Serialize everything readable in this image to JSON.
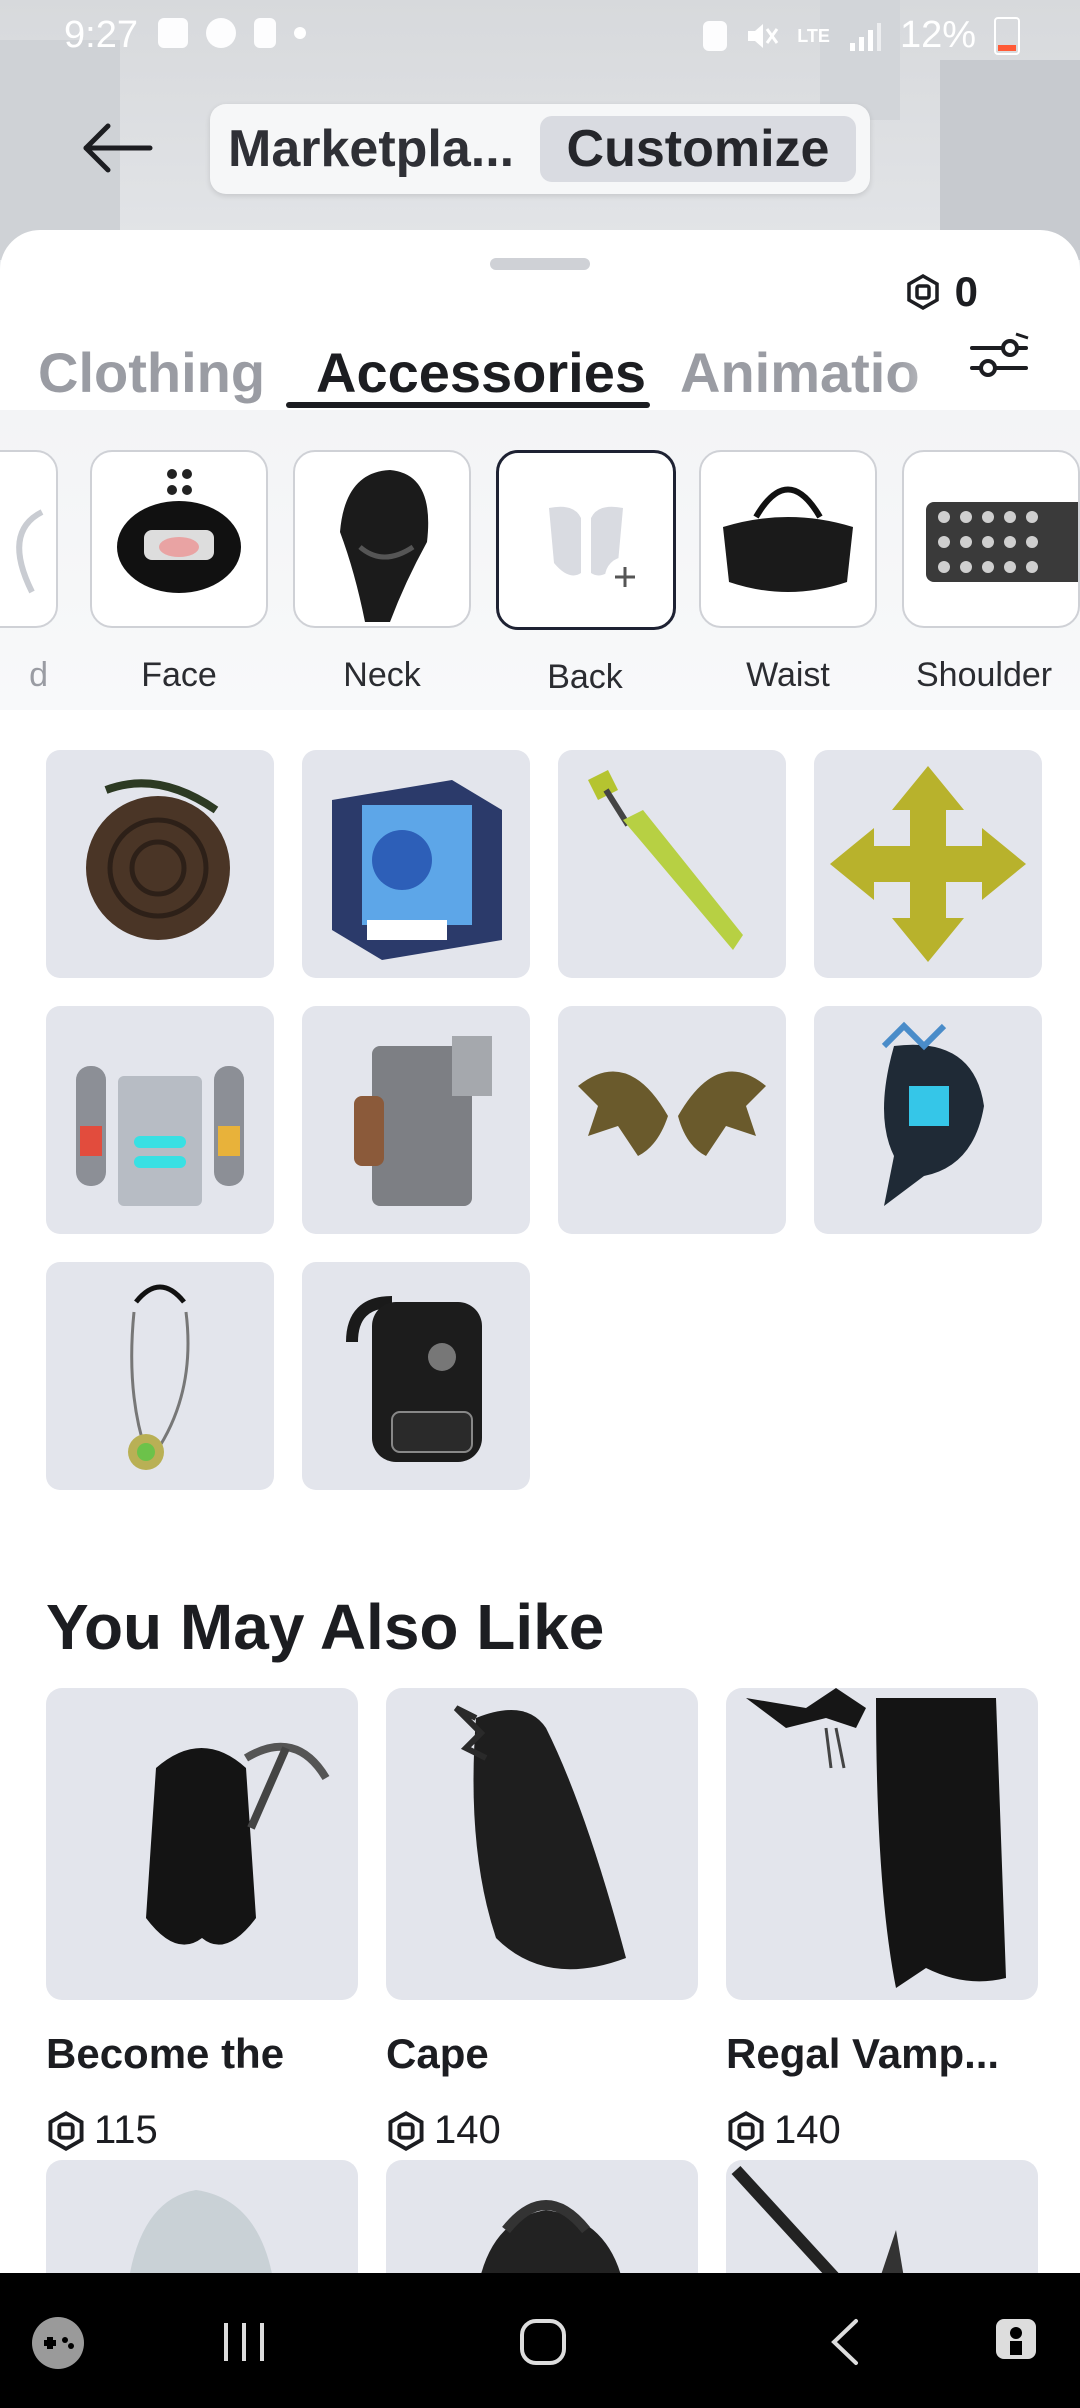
{
  "status_bar": {
    "time": "9:27",
    "battery": "12%",
    "network": "LTE"
  },
  "top_nav": {
    "tab_marketplace": "Marketpla...",
    "tab_customize": "Customize"
  },
  "balance": "0",
  "category_tabs": [
    "Clothing",
    "Accessories",
    "Animatio"
  ],
  "subcategories": [
    {
      "label": "d"
    },
    {
      "label": "Face"
    },
    {
      "label": "Neck"
    },
    {
      "label": "Back"
    },
    {
      "label": "Waist"
    },
    {
      "label": "Shoulder"
    }
  ],
  "inventory_icons": [
    "round-shield-item",
    "innovation-award-crystal-noob",
    "green-sword-item",
    "yellow-arrows-item",
    "jetpack-item",
    "stone-backpack-item",
    "bat-wings-item",
    "blue-dragon-item",
    "pendant-necklace-item",
    "black-backpack-item"
  ],
  "recommendations": {
    "title": "You May Also Like",
    "items": [
      {
        "name": "Become the",
        "price": "115"
      },
      {
        "name": "Cape",
        "price": "140"
      },
      {
        "name": "Regal Vamp...",
        "price": "140"
      }
    ]
  },
  "colors": {
    "accent": "#1e2233",
    "tile_bg": "#e3e5ec",
    "muted_tab": "#9a9ca3"
  }
}
